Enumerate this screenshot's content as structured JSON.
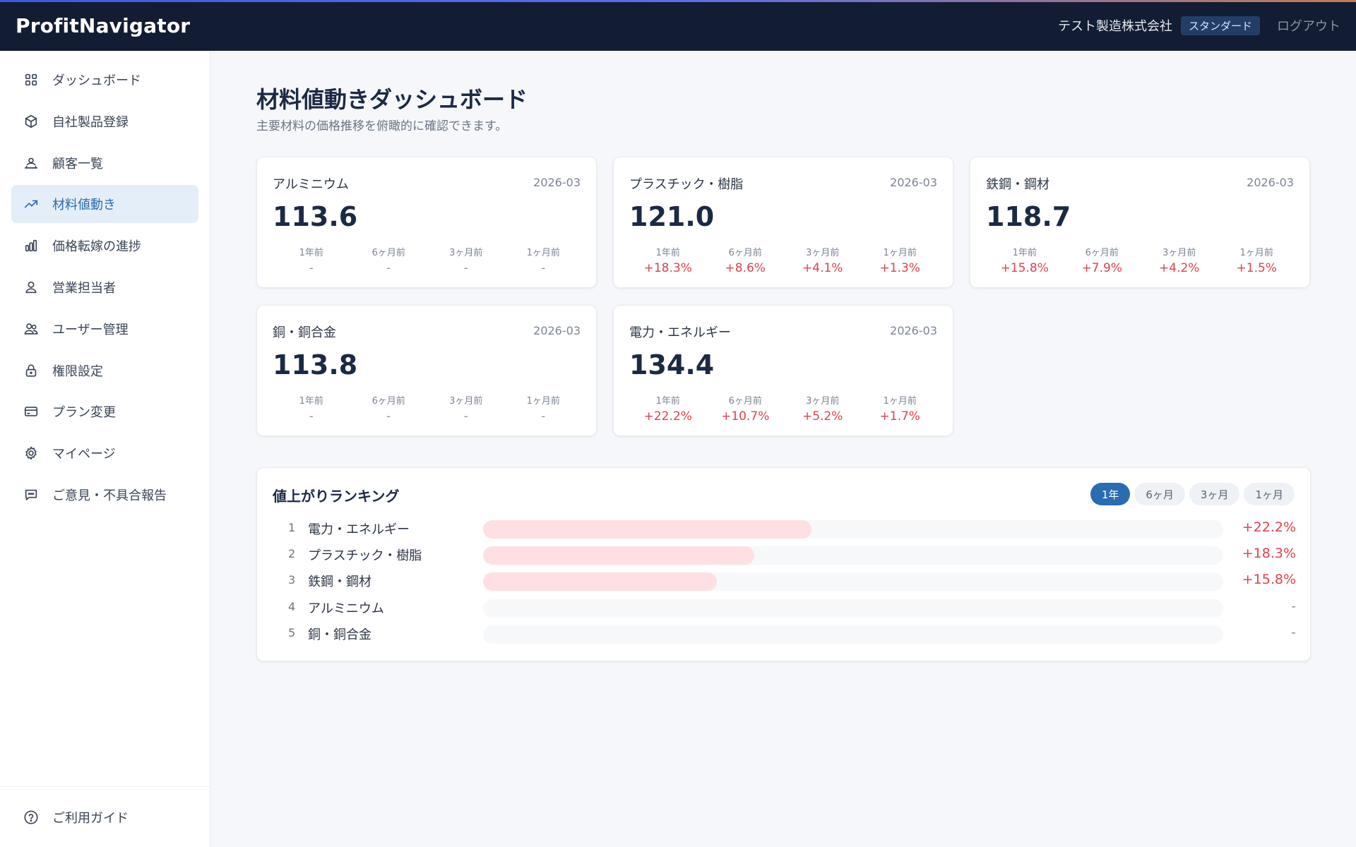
{
  "header": {
    "brand": "ProfitNavigator",
    "company": "テスト製造株式会社",
    "plan": "スタンダード",
    "logout": "ログアウト"
  },
  "sidebar": {
    "items": [
      {
        "label": "ダッシュボード",
        "icon": "grid-icon"
      },
      {
        "label": "自社製品登録",
        "icon": "box-icon"
      },
      {
        "label": "顧客一覧",
        "icon": "customers-icon"
      },
      {
        "label": "材料値動き",
        "icon": "trending-up-icon",
        "active": true
      },
      {
        "label": "価格転嫁の進捗",
        "icon": "bar-chart-icon"
      },
      {
        "label": "営業担当者",
        "icon": "user-icon"
      },
      {
        "label": "ユーザー管理",
        "icon": "users-icon"
      },
      {
        "label": "権限設定",
        "icon": "lock-icon"
      },
      {
        "label": "プラン変更",
        "icon": "credit-card-icon"
      },
      {
        "label": "マイページ",
        "icon": "gear-icon"
      },
      {
        "label": "ご意見・不具合報告",
        "icon": "message-icon"
      }
    ],
    "footer": {
      "label": "ご利用ガイド",
      "icon": "help-icon"
    }
  },
  "main": {
    "title": "材料値動きダッシュボード",
    "subtitle": "主要材料の価格推移を俯瞰的に確認できます。",
    "period_labels": [
      "1年前",
      "6ヶ月前",
      "3ヶ月前",
      "1ヶ月前"
    ],
    "cards": [
      {
        "name": "アルミニウム",
        "date": "2026-03",
        "value": "113.6",
        "changes": [
          "-",
          "-",
          "-",
          "-"
        ]
      },
      {
        "name": "プラスチック・樹脂",
        "date": "2026-03",
        "value": "121.0",
        "changes": [
          "+18.3%",
          "+8.6%",
          "+4.1%",
          "+1.3%"
        ]
      },
      {
        "name": "鉄鋼・鋼材",
        "date": "2026-03",
        "value": "118.7",
        "changes": [
          "+15.8%",
          "+7.9%",
          "+4.2%",
          "+1.5%"
        ]
      },
      {
        "name": "銅・銅合金",
        "date": "2026-03",
        "value": "113.8",
        "changes": [
          "-",
          "-",
          "-",
          "-"
        ]
      },
      {
        "name": "電力・エネルギー",
        "date": "2026-03",
        "value": "134.4",
        "changes": [
          "+22.2%",
          "+10.7%",
          "+5.2%",
          "+1.7%"
        ]
      }
    ],
    "ranking": {
      "title": "値上がりランキング",
      "tabs": [
        "1年",
        "6ヶ月",
        "3ヶ月",
        "1ヶ月"
      ],
      "active_tab": 0,
      "max_percent": 50,
      "rows": [
        {
          "rank": "1",
          "name": "電力・エネルギー",
          "value": "+22.2%",
          "percent": 22.2
        },
        {
          "rank": "2",
          "name": "プラスチック・樹脂",
          "value": "+18.3%",
          "percent": 18.3
        },
        {
          "rank": "3",
          "name": "鉄鋼・鋼材",
          "value": "+15.8%",
          "percent": 15.8
        },
        {
          "rank": "4",
          "name": "アルミニウム",
          "value": "-",
          "percent": 0
        },
        {
          "rank": "5",
          "name": "銅・銅合金",
          "value": "-",
          "percent": 0
        }
      ]
    }
  },
  "colors": {
    "header_bg": "#121c33",
    "accent": "#2a6cb0",
    "up": "#e0414b",
    "bar_fill": "#fee0e2"
  }
}
